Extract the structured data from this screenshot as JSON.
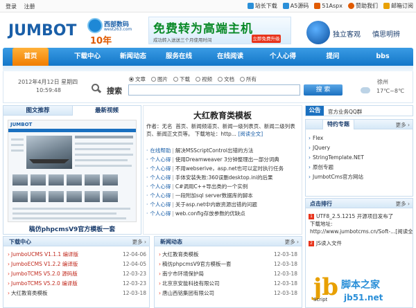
{
  "topbar": {
    "left": [
      "登录",
      "注册"
    ],
    "right": [
      {
        "label": "站长下载",
        "icon": "download-icon",
        "color": "#2a8fd8"
      },
      {
        "label": "A5源码",
        "icon": "a5-icon",
        "color": "#2a8fd8"
      },
      {
        "label": "51Aspx",
        "icon": "aspx-icon",
        "color": "#e05a00"
      },
      {
        "label": "赞助我们",
        "icon": "heart-icon",
        "color": "#e05a00"
      },
      {
        "label": "邮箱订阅",
        "icon": "mail-icon",
        "color": "#e8a000"
      }
    ]
  },
  "header": {
    "logo": "JUMBOT",
    "west_name": "西部数码",
    "west_url": "west263.com",
    "west_years": "10年",
    "banner_big": "免费转为高端主机",
    "banner_small": "成功转入送送三个月使用时间",
    "banner_btn": "立即免费升级",
    "slogan1": "独立客观",
    "slogan2": "慎思明辨"
  },
  "nav": {
    "home": "首页",
    "items": [
      "下载中心",
      "新闻动态",
      "服务在线",
      "在线阅读",
      "个人心得",
      "提问",
      "bbs"
    ]
  },
  "search": {
    "date_line1": "2012年4月12日 星期四",
    "date_line2": "10:59:48",
    "label": "搜索",
    "options": [
      "文章",
      "图片",
      "下载",
      "视频",
      "文档",
      "所有"
    ],
    "selected": 0,
    "button": "搜 索",
    "placeholder": "",
    "city": "徐州",
    "temp": "17℃~8℃"
  },
  "left_tabs": {
    "tab1": "图文推荐",
    "tab2": "最新视频",
    "mini_logo": "JUMBOT",
    "caption": "稿仿phpcmsV9官方模板一套"
  },
  "article": {
    "title": "大红教育类模板",
    "meta_author_label": "作者：无名",
    "meta_body": "首页、新闻频道页、新闻一级列表页、新闻二级列表页、新闻正文页等。",
    "meta_link_label": "下载地址：http...",
    "meta_read": "[阅读全文]",
    "rows": [
      {
        "cat": "在线帮助",
        "text": "解决MSScriptControl出错的方法"
      },
      {
        "cat": "个人心得",
        "text": "使用Dreamweaver 3分钟整理出一部分词典"
      },
      {
        "cat": "个人心得",
        "text": "不用webserive，asp.net也可以定时执行任务"
      },
      {
        "cat": "个人心得",
        "text": "手体安装失败:360误删desktop.ini的后果"
      },
      {
        "cat": "个人心得",
        "text": "C#调用C++导出类的一个实例"
      },
      {
        "cat": "个人心得",
        "text": "一段附加sql server数据库的脚本"
      },
      {
        "cat": "个人心得",
        "text": "关于asp.net中内嵌资源出错的问题"
      },
      {
        "cat": "个人心得",
        "text": "web.config存放参数的优缺点"
      }
    ]
  },
  "notice": {
    "tag": "公告",
    "text": "官方业务QQ群"
  },
  "special": {
    "title": "特约专题",
    "more": "更多",
    "items": [
      "Flex",
      "JQuery",
      "StringTemplate.NET",
      "原创专题",
      "JumbotCms官方网站"
    ]
  },
  "hot": {
    "title": "点击排行",
    "more": "更多",
    "rows": [
      {
        "num": "1",
        "text": "UTF8_2.5.1215 开源项目发布了"
      },
      {
        "num": "",
        "text": "下载地址:"
      },
      {
        "num": "",
        "text": "http://www.jumbotcms.cn/Soft-...[阅读全文]"
      },
      {
        "num": "2",
        "text": "JS读入文件"
      }
    ]
  },
  "download": {
    "title": "下载中心",
    "more": "更多",
    "rows": [
      {
        "text": "JumboUCMS V1.1.1 编译版",
        "date": "12-04-06",
        "red": true
      },
      {
        "text": "JumboECMS V1.2.2 编译版",
        "date": "12-04-05",
        "red": true
      },
      {
        "text": "JumboTCMS V5.2.0 源码版",
        "date": "12-03-23",
        "red": true
      },
      {
        "text": "JumboTCMS V5.2.0 编译版",
        "date": "12-03-23",
        "red": true
      },
      {
        "text": "大红教育类模板",
        "date": "12-03-18",
        "red": false
      }
    ]
  },
  "news": {
    "title": "新闻动态",
    "more": "更多",
    "rows": [
      {
        "text": "大红教育类模板",
        "date": "12-03-18"
      },
      {
        "text": "稿仿phpcmsV9官方模板一套",
        "date": "12-03-18"
      },
      {
        "text": "南宁市环境保护局",
        "date": "12-03-18"
      },
      {
        "text": "北京京安能科技有限公司",
        "date": "12-03-18"
      },
      {
        "text": "唐山西铭集团有限公司",
        "date": "12-03-18"
      }
    ]
  },
  "watermark": {
    "jb": "jb",
    "t1": "脚本之家",
    "t2": "jb51.net",
    "script": "Script"
  }
}
